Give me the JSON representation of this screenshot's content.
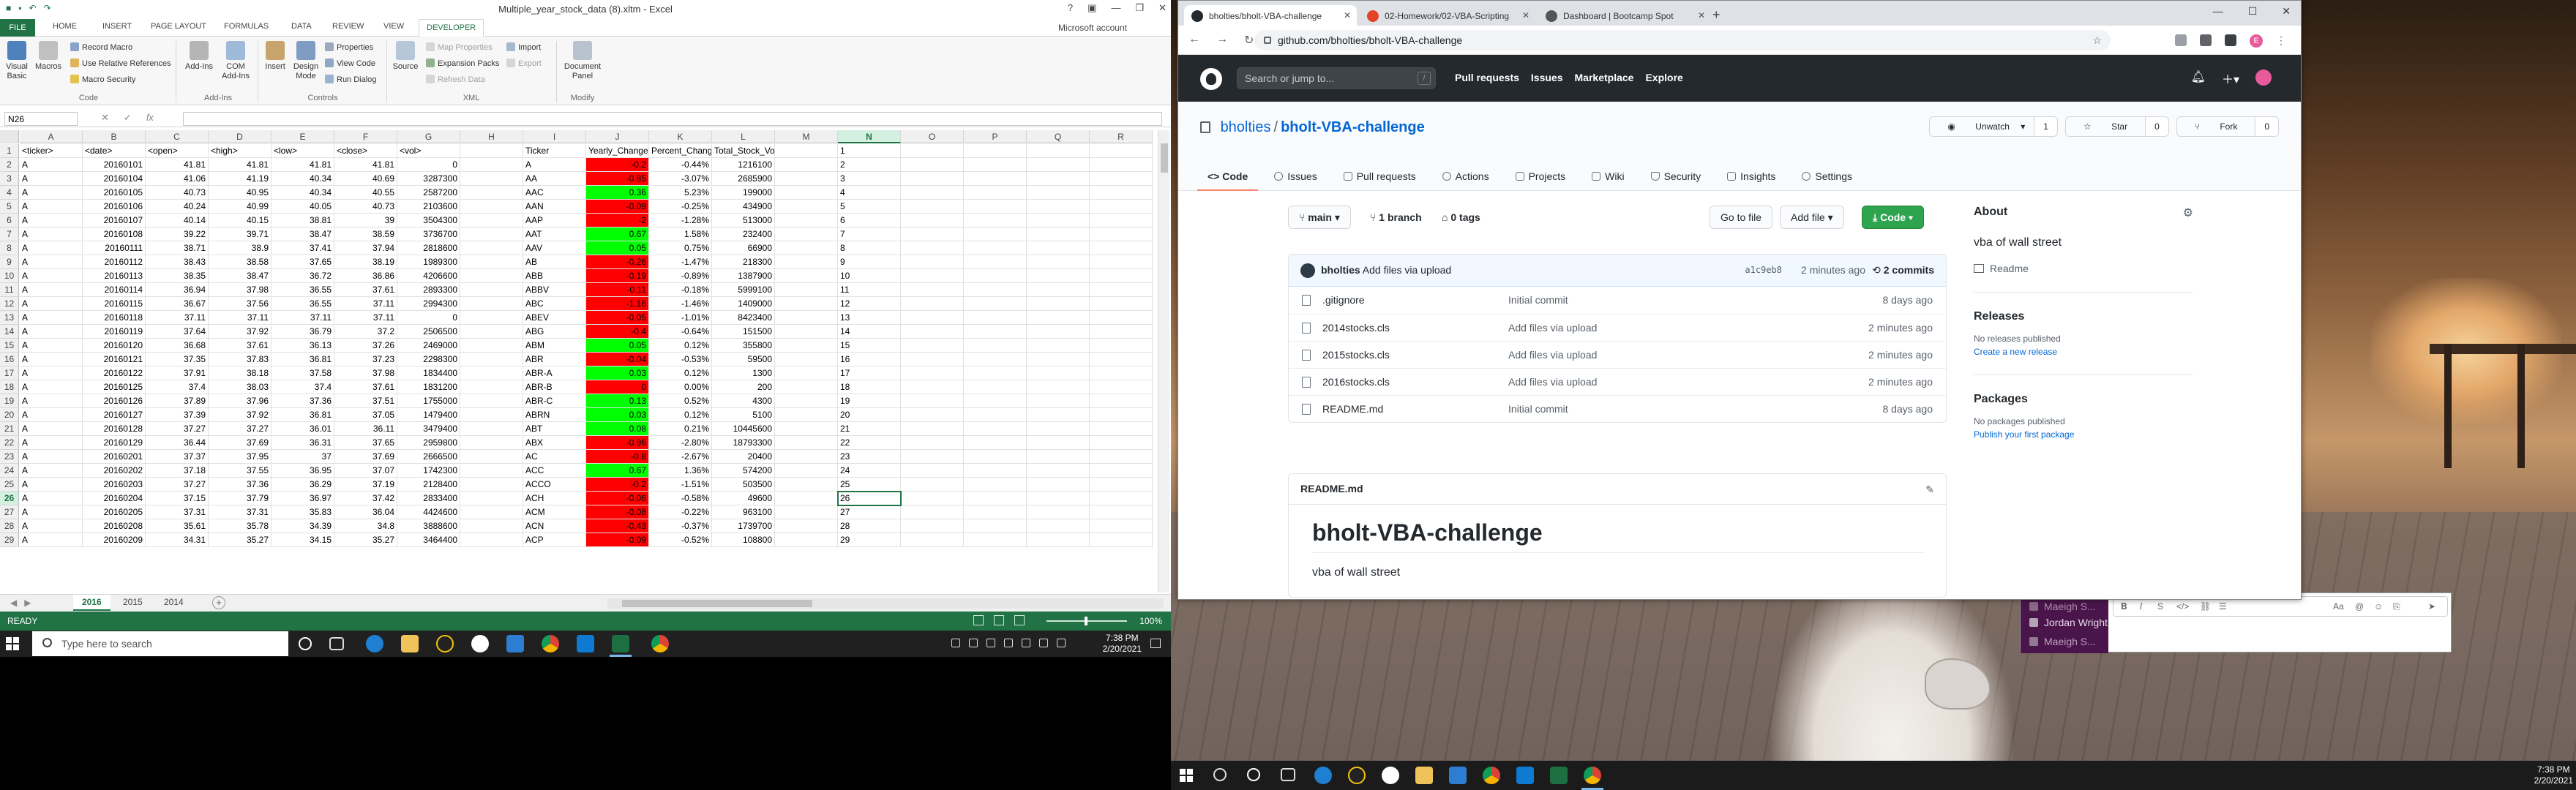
{
  "excel": {
    "window_title": "Multiple_year_stock_data (8).xltm - Excel",
    "ribbon_tabs": [
      "FILE",
      "HOME",
      "INSERT",
      "PAGE LAYOUT",
      "FORMULAS",
      "DATA",
      "REVIEW",
      "VIEW",
      "DEVELOPER"
    ],
    "active_tab": "DEVELOPER",
    "account": "Microsoft account",
    "ribbon": {
      "visual_basic": "Visual Basic",
      "macros": "Macros",
      "record_macro": "Record Macro",
      "use_relative": "Use Relative References",
      "macro_security": "Macro Security",
      "group_code": "Code",
      "add_ins": "Add-Ins",
      "com_add_ins": "COM Add-Ins",
      "group_addins": "Add-Ins",
      "insert": "Insert",
      "design_mode": "Design Mode",
      "properties": "Properties",
      "view_code": "View Code",
      "run_dialog": "Run Dialog",
      "group_controls": "Controls",
      "source": "Source",
      "map_properties": "Map Properties",
      "expansion_packs": "Expansion Packs",
      "refresh_data": "Refresh Data",
      "import": "Import",
      "export": "Export",
      "group_xml": "XML",
      "document_panel": "Document Panel",
      "group_modify": "Modify"
    },
    "name_box": "N26",
    "columns": [
      "A",
      "B",
      "C",
      "D",
      "E",
      "F",
      "G",
      "H",
      "I",
      "J",
      "K",
      "L",
      "M",
      "N",
      "O",
      "P",
      "Q",
      "R"
    ],
    "selected_column": "N",
    "selected_row": "26",
    "rows": [
      {
        "n": "1",
        "a": "<ticker>",
        "b": "<date>",
        "c": "<open>",
        "d": "<high>",
        "e": "<low>",
        "f": "<close>",
        "g": "<vol>",
        "i": "Ticker",
        "j": "Yearly_Change",
        "k": "Percent_Change",
        "l": "Total_Stock_Volume",
        "jc": ""
      },
      {
        "n": "2",
        "a": "A",
        "b": "20160101",
        "c": "41.81",
        "d": "41.81",
        "e": "41.81",
        "f": "41.81",
        "g": "0",
        "i": "A",
        "j": "-0.2",
        "k": "-0.44%",
        "l": "1216100",
        "jc": "neg"
      },
      {
        "n": "3",
        "a": "A",
        "b": "20160104",
        "c": "41.06",
        "d": "41.19",
        "e": "40.34",
        "f": "40.69",
        "g": "3287300",
        "i": "AA",
        "j": "-0.85",
        "k": "-3.07%",
        "l": "2685900",
        "jc": "neg"
      },
      {
        "n": "4",
        "a": "A",
        "b": "20160105",
        "c": "40.73",
        "d": "40.95",
        "e": "40.34",
        "f": "40.55",
        "g": "2587200",
        "i": "AAC",
        "j": "0.36",
        "k": "5.23%",
        "l": "199000",
        "jc": "pos"
      },
      {
        "n": "5",
        "a": "A",
        "b": "20160106",
        "c": "40.24",
        "d": "40.99",
        "e": "40.05",
        "f": "40.73",
        "g": "2103600",
        "i": "AAN",
        "j": "-0.09",
        "k": "-0.25%",
        "l": "434900",
        "jc": "neg"
      },
      {
        "n": "6",
        "a": "A",
        "b": "20160107",
        "c": "40.14",
        "d": "40.15",
        "e": "38.81",
        "f": "39",
        "g": "3504300",
        "i": "AAP",
        "j": "-2",
        "k": "-1.28%",
        "l": "513000",
        "jc": "neg"
      },
      {
        "n": "7",
        "a": "A",
        "b": "20160108",
        "c": "39.22",
        "d": "39.71",
        "e": "38.47",
        "f": "38.59",
        "g": "3736700",
        "i": "AAT",
        "j": "0.67",
        "k": "1.58%",
        "l": "232400",
        "jc": "pos"
      },
      {
        "n": "8",
        "a": "A",
        "b": "20160111",
        "c": "38.71",
        "d": "38.9",
        "e": "37.41",
        "f": "37.94",
        "g": "2818600",
        "i": "AAV",
        "j": "0.05",
        "k": "0.75%",
        "l": "66900",
        "jc": "pos"
      },
      {
        "n": "9",
        "a": "A",
        "b": "20160112",
        "c": "38.43",
        "d": "38.58",
        "e": "37.65",
        "f": "38.19",
        "g": "1989300",
        "i": "AB",
        "j": "-0.26",
        "k": "-1.47%",
        "l": "218300",
        "jc": "neg"
      },
      {
        "n": "10",
        "a": "A",
        "b": "20160113",
        "c": "38.35",
        "d": "38.47",
        "e": "36.72",
        "f": "36.86",
        "g": "4206600",
        "i": "ABB",
        "j": "-0.19",
        "k": "-0.89%",
        "l": "1387900",
        "jc": "neg"
      },
      {
        "n": "11",
        "a": "A",
        "b": "20160114",
        "c": "36.94",
        "d": "37.98",
        "e": "36.55",
        "f": "37.61",
        "g": "2893300",
        "i": "ABBV",
        "j": "-0.11",
        "k": "-0.18%",
        "l": "5999100",
        "jc": "neg"
      },
      {
        "n": "12",
        "a": "A",
        "b": "20160115",
        "c": "36.67",
        "d": "37.56",
        "e": "36.55",
        "f": "37.11",
        "g": "2994300",
        "i": "ABC",
        "j": "-1.16",
        "k": "-1.46%",
        "l": "1409000",
        "jc": "neg"
      },
      {
        "n": "13",
        "a": "A",
        "b": "20160118",
        "c": "37.11",
        "d": "37.11",
        "e": "37.11",
        "f": "37.11",
        "g": "0",
        "i": "ABEV",
        "j": "-0.05",
        "k": "-1.01%",
        "l": "8423400",
        "jc": "neg"
      },
      {
        "n": "14",
        "a": "A",
        "b": "20160119",
        "c": "37.64",
        "d": "37.92",
        "e": "36.79",
        "f": "37.2",
        "g": "2506500",
        "i": "ABG",
        "j": "-0.4",
        "k": "-0.64%",
        "l": "151500",
        "jc": "neg"
      },
      {
        "n": "15",
        "a": "A",
        "b": "20160120",
        "c": "36.68",
        "d": "37.61",
        "e": "36.13",
        "f": "37.26",
        "g": "2469000",
        "i": "ABM",
        "j": "0.05",
        "k": "0.12%",
        "l": "355800",
        "jc": "pos"
      },
      {
        "n": "16",
        "a": "A",
        "b": "20160121",
        "c": "37.35",
        "d": "37.83",
        "e": "36.81",
        "f": "37.23",
        "g": "2298300",
        "i": "ABR",
        "j": "-0.04",
        "k": "-0.53%",
        "l": "59500",
        "jc": "neg"
      },
      {
        "n": "17",
        "a": "A",
        "b": "20160122",
        "c": "37.91",
        "d": "38.18",
        "e": "37.58",
        "f": "37.98",
        "g": "1834400",
        "i": "ABR-A",
        "j": "0.03",
        "k": "0.12%",
        "l": "1300",
        "jc": "pos"
      },
      {
        "n": "18",
        "a": "A",
        "b": "20160125",
        "c": "37.4",
        "d": "38.03",
        "e": "37.4",
        "f": "37.61",
        "g": "1831200",
        "i": "ABR-B",
        "j": "0",
        "k": "0.00%",
        "l": "200",
        "jc": "neg"
      },
      {
        "n": "19",
        "a": "A",
        "b": "20160126",
        "c": "37.89",
        "d": "37.96",
        "e": "37.36",
        "f": "37.51",
        "g": "1755000",
        "i": "ABR-C",
        "j": "0.13",
        "k": "0.52%",
        "l": "4300",
        "jc": "pos"
      },
      {
        "n": "20",
        "a": "A",
        "b": "20160127",
        "c": "37.39",
        "d": "37.92",
        "e": "36.81",
        "f": "37.05",
        "g": "1479400",
        "i": "ABRN",
        "j": "0.03",
        "k": "0.12%",
        "l": "5100",
        "jc": "pos"
      },
      {
        "n": "21",
        "a": "A",
        "b": "20160128",
        "c": "37.27",
        "d": "37.27",
        "e": "36.01",
        "f": "36.11",
        "g": "3479400",
        "i": "ABT",
        "j": "0.08",
        "k": "0.21%",
        "l": "10445600",
        "jc": "pos"
      },
      {
        "n": "22",
        "a": "A",
        "b": "20160129",
        "c": "36.44",
        "d": "37.69",
        "e": "36.31",
        "f": "37.65",
        "g": "2959800",
        "i": "ABX",
        "j": "-0.96",
        "k": "-2.80%",
        "l": "18793300",
        "jc": "neg"
      },
      {
        "n": "23",
        "a": "A",
        "b": "20160201",
        "c": "37.37",
        "d": "37.95",
        "e": "37",
        "f": "37.69",
        "g": "2666500",
        "i": "AC",
        "j": "-0.8",
        "k": "-2.67%",
        "l": "20400",
        "jc": "neg"
      },
      {
        "n": "24",
        "a": "A",
        "b": "20160202",
        "c": "37.18",
        "d": "37.55",
        "e": "36.95",
        "f": "37.07",
        "g": "1742300",
        "i": "ACC",
        "j": "0.67",
        "k": "1.36%",
        "l": "574200",
        "jc": "pos"
      },
      {
        "n": "25",
        "a": "A",
        "b": "20160203",
        "c": "37.27",
        "d": "37.36",
        "e": "36.29",
        "f": "37.19",
        "g": "2128400",
        "i": "ACCO",
        "j": "-0.2",
        "k": "-1.51%",
        "l": "503500",
        "jc": "neg"
      },
      {
        "n": "26",
        "a": "A",
        "b": "20160204",
        "c": "37.15",
        "d": "37.79",
        "e": "36.97",
        "f": "37.42",
        "g": "2833400",
        "i": "ACH",
        "j": "-0.06",
        "k": "-0.58%",
        "l": "49600",
        "jc": "neg"
      },
      {
        "n": "27",
        "a": "A",
        "b": "20160205",
        "c": "37.31",
        "d": "37.31",
        "e": "35.83",
        "f": "36.04",
        "g": "4424600",
        "i": "ACM",
        "j": "-0.08",
        "k": "-0.22%",
        "l": "963100",
        "jc": "neg"
      },
      {
        "n": "28",
        "a": "A",
        "b": "20160208",
        "c": "35.61",
        "d": "35.78",
        "e": "34.39",
        "f": "34.8",
        "g": "3888600",
        "i": "ACN",
        "j": "-0.43",
        "k": "-0.37%",
        "l": "1739700",
        "jc": "neg"
      },
      {
        "n": "29",
        "a": "A",
        "b": "20160209",
        "c": "34.31",
        "d": "35.27",
        "e": "34.15",
        "f": "35.27",
        "g": "3464400",
        "i": "ACP",
        "j": "-0.09",
        "k": "-0.52%",
        "l": "108800",
        "jc": "neg"
      }
    ],
    "sheets": [
      "2016",
      "2015",
      "2014"
    ],
    "active_sheet": "2016",
    "status": "READY",
    "zoom": "100%"
  },
  "taskbar1": {
    "search_placeholder": "Type here to search",
    "time": "7:38 PM",
    "date": "2/20/2021"
  },
  "chat": {
    "items": [
      "Jordan Wright",
      "Maeigh S..."
    ]
  },
  "browser": {
    "tabs": [
      {
        "title": "bholties/bholt-VBA-challenge",
        "favicon_color": "#24292e"
      },
      {
        "title": "02-Homework/02-VBA-Scripting",
        "favicon_color": "#e24329"
      },
      {
        "title": "Dashboard | Bootcamp Spot",
        "favicon_color": "#555555"
      }
    ],
    "url": "github.com/bholties/bholt-VBA-challenge",
    "profile_initial": "E"
  },
  "github": {
    "search_placeholder": "Search or jump to...",
    "nav": [
      "Pull requests",
      "Issues",
      "Marketplace",
      "Explore"
    ],
    "owner": "bholties",
    "repo": "bholt-VBA-challenge",
    "unwatch": "Unwatch",
    "unwatch_count": "1",
    "star": "Star",
    "star_count": "0",
    "fork": "Fork",
    "fork_count": "0",
    "tabs": [
      "Code",
      "Issues",
      "Pull requests",
      "Actions",
      "Projects",
      "Wiki",
      "Security",
      "Insights",
      "Settings"
    ],
    "branch": "main",
    "branches": "1 branch",
    "tags": "0 tags",
    "go_to_file": "Go to file",
    "add_file": "Add file",
    "code_btn": "Code",
    "commit": {
      "author": "bholties",
      "message": "Add files via upload",
      "sha": "a1c9eb8",
      "when": "2 minutes ago",
      "commits": "2 commits"
    },
    "files": [
      {
        "name": ".gitignore",
        "message": "Initial commit",
        "age": "8 days ago"
      },
      {
        "name": "2014stocks.cls",
        "message": "Add files via upload",
        "age": "2 minutes ago"
      },
      {
        "name": "2015stocks.cls",
        "message": "Add files via upload",
        "age": "2 minutes ago"
      },
      {
        "name": "2016stocks.cls",
        "message": "Add files via upload",
        "age": "2 minutes ago"
      },
      {
        "name": "README.md",
        "message": "Initial commit",
        "age": "8 days ago"
      }
    ],
    "readme_label": "README.md",
    "readme_title": "bholt-VBA-challenge",
    "readme_body": "vba of wall street",
    "about": "About",
    "about_desc": "vba of wall street",
    "readme_link": "Readme",
    "releases": "Releases",
    "no_releases": "No releases published",
    "create_release": "Create a new release",
    "packages": "Packages",
    "no_packages": "No packages published",
    "publish_package": "Publish your first package"
  },
  "taskbar2": {
    "time": "7:38 PM",
    "date": "2/20/2021"
  }
}
